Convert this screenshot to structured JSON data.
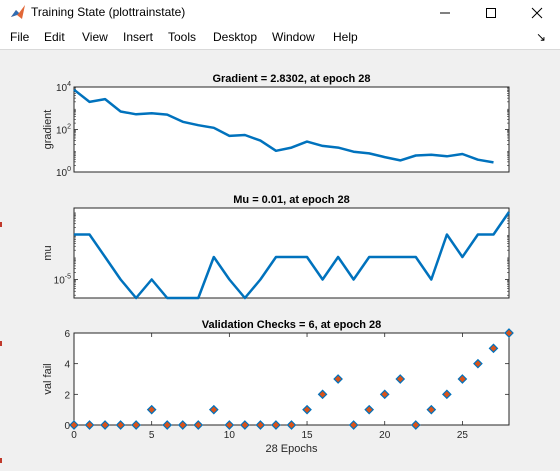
{
  "window": {
    "title": "Training State (plottrainstate)",
    "minimize_icon": "minimize-icon",
    "maximize_icon": "maximize-icon",
    "close_icon": "close-icon"
  },
  "menu": {
    "items": [
      "File",
      "Edit",
      "View",
      "Insert",
      "Tools",
      "Desktop",
      "Window",
      "Help"
    ],
    "dock_icon": "dock-arrow-icon"
  },
  "colors": {
    "line": "#0072BD",
    "marker_fill": "#D95319",
    "marker_edge": "#0072BD",
    "axes_bg": "#ffffff"
  },
  "chart_data": [
    {
      "type": "line",
      "title": "Gradient = 2.8302, at epoch 28",
      "xlabel": "",
      "ylabel": "gradient",
      "yscale": "log",
      "xlim": [
        0,
        28
      ],
      "ylim": [
        1,
        10000
      ],
      "y_ticks": [
        1,
        100,
        10000
      ],
      "y_tick_labels": [
        {
          "base": "10",
          "exp": "0"
        },
        {
          "base": "10",
          "exp": "2"
        },
        {
          "base": "10",
          "exp": "4"
        }
      ],
      "x": [
        0,
        1,
        2,
        3,
        4,
        5,
        6,
        7,
        8,
        9,
        10,
        11,
        12,
        13,
        14,
        15,
        16,
        17,
        18,
        19,
        20,
        21,
        22,
        23,
        24,
        25,
        26,
        27,
        28
      ],
      "values": [
        7500,
        2000,
        2700,
        700,
        520,
        580,
        500,
        230,
        160,
        120,
        50,
        55,
        30,
        10,
        14,
        27,
        17,
        14,
        9,
        7.5,
        5,
        3.5,
        6,
        6.5,
        5.5,
        7,
        3.8,
        2.8302
      ]
    },
    {
      "type": "line",
      "title": "Mu = 0.01, at epoch 28",
      "xlabel": "",
      "ylabel": "mu",
      "yscale": "log",
      "xlim": [
        0,
        28
      ],
      "ylim": [
        1.5e-06,
        0.015
      ],
      "y_ticks": [
        1e-05
      ],
      "y_tick_labels": [
        {
          "base": "10",
          "exp": "-5"
        }
      ],
      "x": [
        0,
        1,
        2,
        3,
        4,
        5,
        6,
        7,
        8,
        9,
        10,
        11,
        12,
        13,
        14,
        15,
        16,
        17,
        18,
        19,
        20,
        21,
        22,
        23,
        24,
        25,
        26,
        27,
        28
      ],
      "values": [
        0.001,
        0.001,
        0.0001,
        1e-05,
        1e-06,
        1e-05,
        1e-06,
        1e-06,
        1e-06,
        0.0001,
        1e-05,
        1e-06,
        1e-05,
        0.0001,
        0.0001,
        0.0001,
        1e-05,
        0.0001,
        1e-05,
        0.0001,
        0.0001,
        0.0001,
        0.0001,
        1e-05,
        0.001,
        0.0001,
        0.001,
        0.001,
        0.01
      ]
    },
    {
      "type": "scatter",
      "title": "Validation Checks = 6, at epoch 28",
      "xlabel": "28 Epochs",
      "ylabel": "val fail",
      "xlim": [
        0,
        28
      ],
      "ylim": [
        0,
        6
      ],
      "x_ticks": [
        0,
        5,
        10,
        15,
        20,
        25
      ],
      "y_ticks": [
        0,
        2,
        4,
        6
      ],
      "x": [
        0,
        1,
        2,
        3,
        4,
        5,
        6,
        7,
        8,
        9,
        10,
        11,
        12,
        13,
        14,
        15,
        16,
        17,
        18,
        19,
        20,
        21,
        22,
        23,
        24,
        25,
        26,
        27,
        28
      ],
      "values": [
        0,
        0,
        0,
        0,
        0,
        1,
        0,
        0,
        0,
        1,
        0,
        0,
        0,
        0,
        0,
        1,
        2,
        3,
        0,
        1,
        2,
        3,
        0,
        1,
        2,
        3,
        4,
        5,
        6
      ]
    }
  ]
}
